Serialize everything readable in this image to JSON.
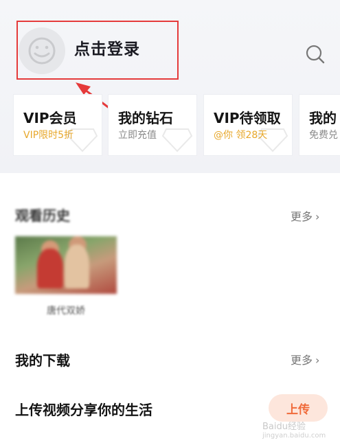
{
  "header": {
    "login_label": "点击登录"
  },
  "cards": [
    {
      "title": "VIP会员",
      "subtitle": "VIP限时5折",
      "subtitle_color": "gold"
    },
    {
      "title": "我的钻石",
      "subtitle": "立即充值",
      "subtitle_color": "gray"
    },
    {
      "title": "VIP待领取",
      "subtitle": "@你 领28天",
      "subtitle_color": "gold"
    },
    {
      "title": "我的",
      "subtitle": "免费兑",
      "subtitle_color": "gray"
    }
  ],
  "history": {
    "title": "观看历史",
    "more_label": "更多",
    "item_caption": "唐代双娇"
  },
  "downloads": {
    "title": "我的下载",
    "more_label": "更多"
  },
  "share": {
    "title": "上传视频分享你的生活",
    "upload_label": "上传"
  },
  "watermark": {
    "text": "Baidu经验",
    "sub": "jingyan.baidu.com"
  },
  "colors": {
    "accent_gold": "#e7a72a",
    "highlight_red": "#e53a3a",
    "upload_orange": "#f06a3a"
  },
  "icons": [
    "avatar-face-icon",
    "search-icon",
    "chevron-right-icon"
  ]
}
